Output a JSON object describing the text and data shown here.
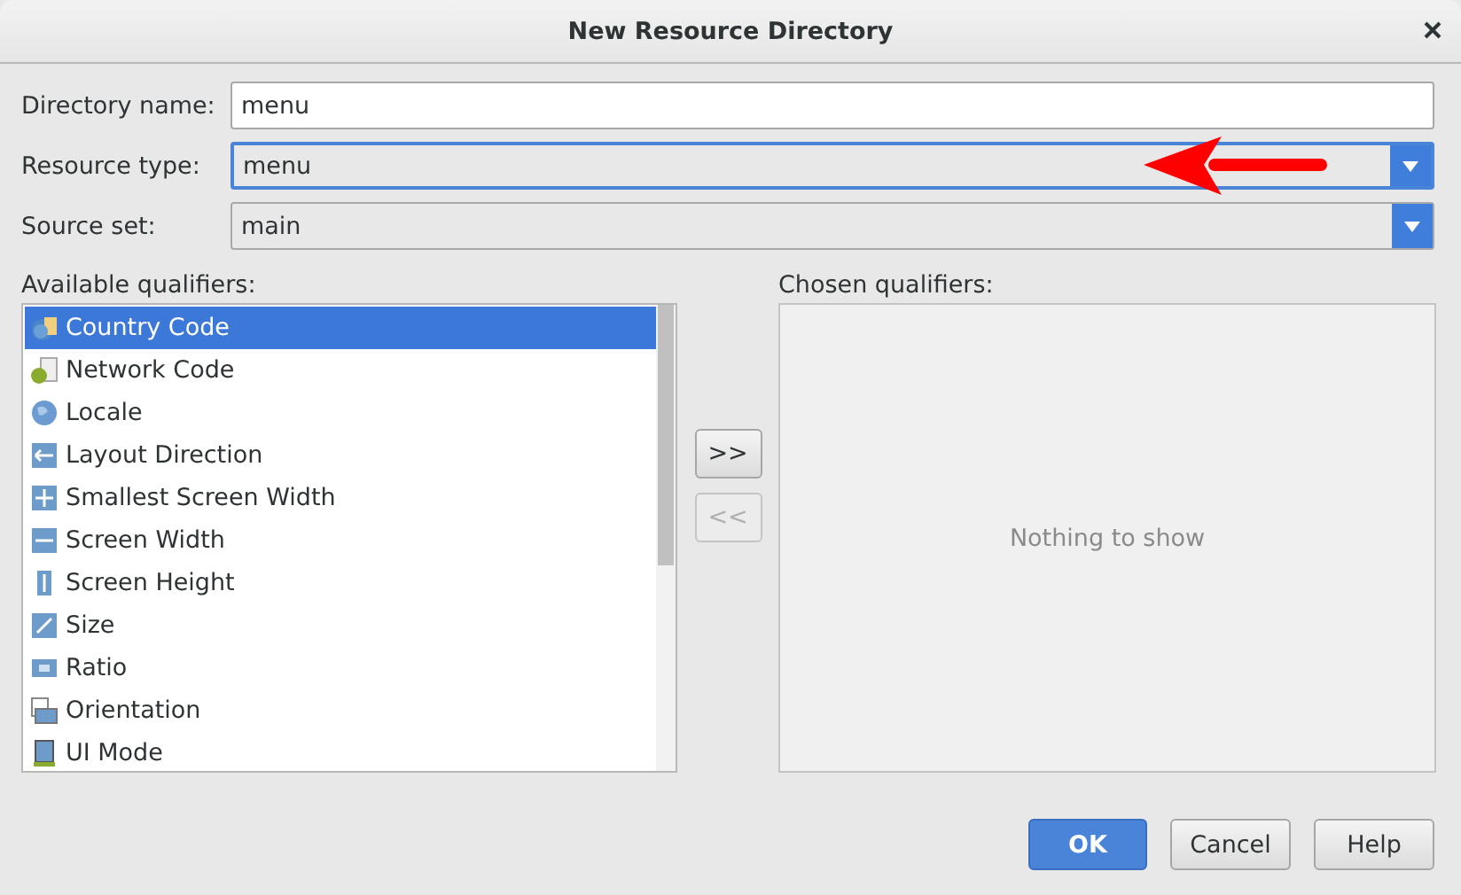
{
  "window": {
    "title": "New Resource Directory"
  },
  "fields": [
    {
      "label": "Directory name:",
      "kind": "text",
      "value": "menu",
      "focused": false
    },
    {
      "label": "Resource type:",
      "kind": "dropdown",
      "value": "menu",
      "focused": true
    },
    {
      "label": "Source set:",
      "kind": "dropdown",
      "value": "main",
      "focused": false
    }
  ],
  "available": {
    "label": "Available qualifiers:",
    "items": [
      {
        "label": "Country Code",
        "selected": true
      },
      {
        "label": "Network Code",
        "selected": false
      },
      {
        "label": "Locale",
        "selected": false
      },
      {
        "label": "Layout Direction",
        "selected": false
      },
      {
        "label": "Smallest Screen Width",
        "selected": false
      },
      {
        "label": "Screen Width",
        "selected": false
      },
      {
        "label": "Screen Height",
        "selected": false
      },
      {
        "label": "Size",
        "selected": false
      },
      {
        "label": "Ratio",
        "selected": false
      },
      {
        "label": "Orientation",
        "selected": false
      },
      {
        "label": "UI Mode",
        "selected": false
      }
    ]
  },
  "transfer_buttons": [
    {
      "label": ">>",
      "disabled": false
    },
    {
      "label": "<<",
      "disabled": true
    }
  ],
  "chosen": {
    "label": "Chosen qualifiers:",
    "empty_text": "Nothing to show"
  },
  "buttons": [
    {
      "label": "OK",
      "kind": "primary"
    },
    {
      "label": "Cancel",
      "kind": "normal"
    },
    {
      "label": "Help",
      "kind": "normal"
    }
  ]
}
